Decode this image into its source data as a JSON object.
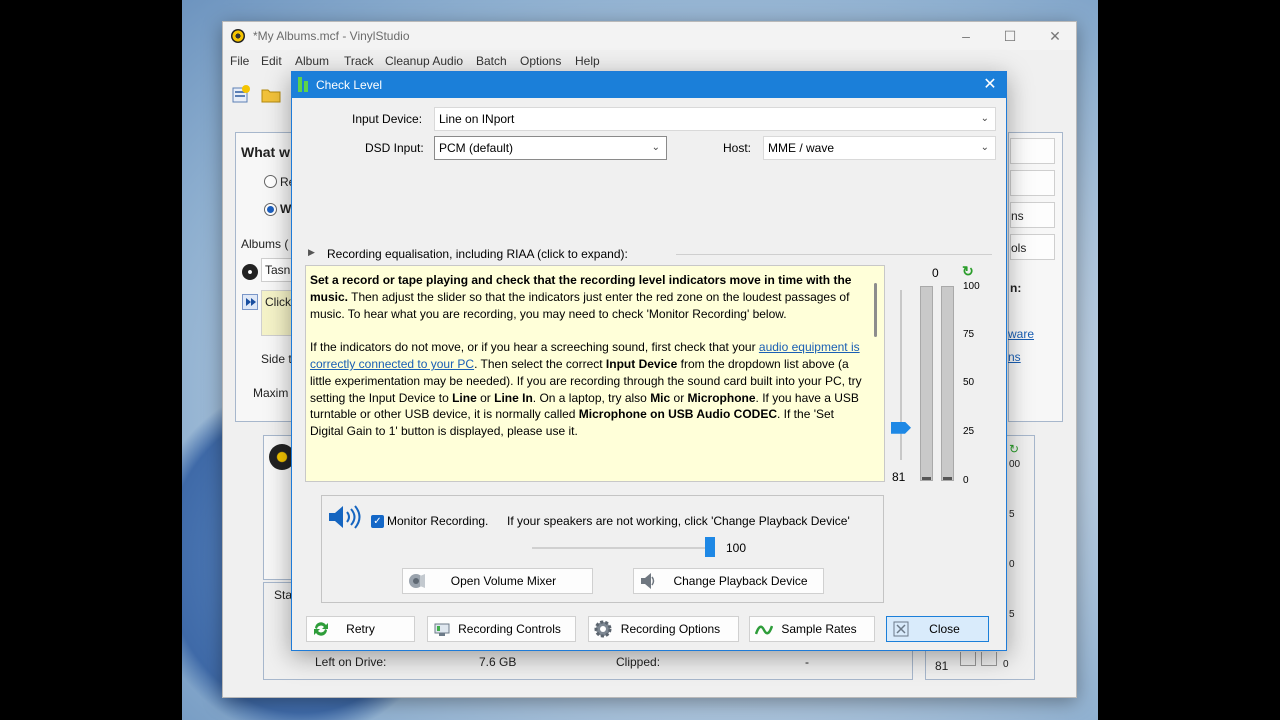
{
  "main_window": {
    "title": "*My Albums.mcf - VinylStudio",
    "menu": [
      "File",
      "Edit",
      "Album",
      "Track",
      "Cleanup Audio",
      "Batch",
      "Options",
      "Help"
    ],
    "partial": {
      "heading": "What w",
      "radio1": "Re",
      "radio2": "W",
      "albums_label": "Albums (",
      "album_field": "Tasn",
      "click_field": "Click",
      "side_label": "Side t",
      "max_label": "Maxim",
      "right_btn3": "ns",
      "right_btn4": "ols",
      "right_colon": "n:",
      "right_link1": "ware",
      "right_link2": "ns",
      "start_label": "Sta",
      "left_on_drive_label": "Left on Drive:",
      "left_on_drive_value": "7.6 GB",
      "clipped_label": "Clipped:",
      "clipped_value": "-",
      "meter2_value": "81",
      "meter2_ticks": [
        "00",
        "5",
        "0",
        "5",
        "0"
      ]
    }
  },
  "dialog": {
    "title": "Check Level",
    "input_device_label": "Input Device:",
    "input_device_value": "Line on INport",
    "dsd_input_label": "DSD Input:",
    "dsd_input_value": "PCM (default)",
    "host_label": "Host:",
    "host_value": "MME / wave",
    "eq_label": "Recording equalisation, including RIAA (click to expand):",
    "help": {
      "p1_bold": "Set a record or tape playing and check that the recording level indicators move in time with the music.",
      "p1_rest": "  Then adjust the slider so that the indicators just enter the red zone on the loudest passages of music.  To hear what you are recording, you may need to check 'Monitor Recording' below.",
      "p2_a": "If the indicators do not move, or if you hear a screeching sound, first check that your ",
      "p2_link": "audio equipment is correctly connected to your PC",
      "p2_b": ".  Then select the correct ",
      "p2_bold1": "Input Device",
      "p2_c": " from the dropdown list above (a little experimentation may be needed).  If you are recording through the sound card built into your PC, try setting the Input Device to ",
      "p2_bold2": "Line",
      "p2_d": " or ",
      "p2_bold3": "Line In",
      "p2_e": ".  On a laptop, try also ",
      "p2_bold4": "Mic",
      "p2_f": " or ",
      "p2_bold5": "Microphone",
      "p2_g": ".  If you have a USB turntable or other USB device, it is normally called ",
      "p2_bold6": "Microphone on USB Audio CODEC",
      "p2_h": ".  If the 'Set Digital Gain to 1' button is displayed, please use it."
    },
    "level": {
      "top_value": "0",
      "gain_value": "81",
      "gain_fraction": 0.19,
      "ticks": [
        "100",
        "75",
        "50",
        "25",
        "0"
      ]
    },
    "monitor": {
      "checkbox_label": "Monitor Recording.",
      "hint": "If your speakers are not working, click 'Change Playback Device'",
      "checked": true,
      "volume_value": "100",
      "volume_fraction": 1.0,
      "open_mixer_label": "Open Volume Mixer",
      "change_device_label": "Change Playback Device"
    },
    "buttons": {
      "retry": "Retry",
      "recording_controls": "Recording Controls",
      "recording_options": "Recording Options",
      "sample_rates": "Sample Rates",
      "close": "Close"
    }
  },
  "colors": {
    "titlebar_blue": "#1b7fd9",
    "help_background": "#ffffd9",
    "link": "#1a5fb4",
    "slider_thumb": "#1e88e5"
  }
}
